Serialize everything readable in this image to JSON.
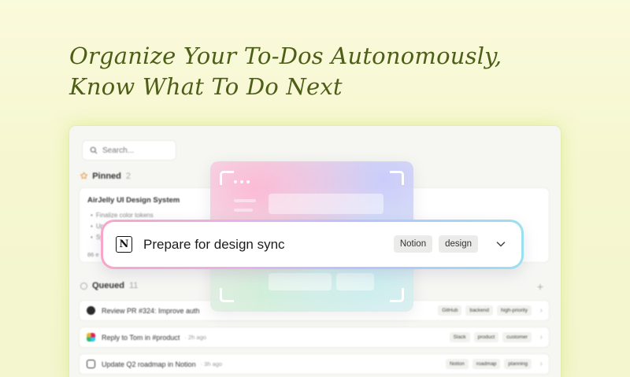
{
  "headline": {
    "line1": "Organize Your To-Dos Autonomously,",
    "line2": "Know What To Do Next"
  },
  "app": {
    "search_placeholder": "Search...",
    "pinned": {
      "label": "Pinned",
      "count": "2",
      "card": {
        "title": "AirJelly UI Design System",
        "bullets": [
          "Finalize color tokens",
          "Up",
          "Sy"
        ],
        "meta": "86 e"
      }
    },
    "queued": {
      "label": "Queued",
      "count": "11",
      "items": [
        {
          "text": "Review PR #324: Improve auth",
          "time": "",
          "icon": "github-icon",
          "tags": [
            "GitHub",
            "backend",
            "high-priority"
          ]
        },
        {
          "text": "Reply to Tom in #product",
          "time": "· 2h ago",
          "icon": "slack-icon",
          "tags": [
            "Slack",
            "product",
            "customer"
          ]
        },
        {
          "text": "Update Q2 roadmap in Notion",
          "time": "· 3h ago",
          "icon": "notion-icon",
          "tags": [
            "Notion",
            "roadmap",
            "planning"
          ]
        }
      ]
    }
  },
  "focus": {
    "title": "Prepare for design sync",
    "icon": "notion-logo-icon",
    "tags": [
      "Notion",
      "design"
    ]
  },
  "colors": {
    "headline": "#4d5e17",
    "background": "#f6f7d0",
    "ring_start": "#f7a6c9",
    "ring_end": "#9be0ef"
  }
}
